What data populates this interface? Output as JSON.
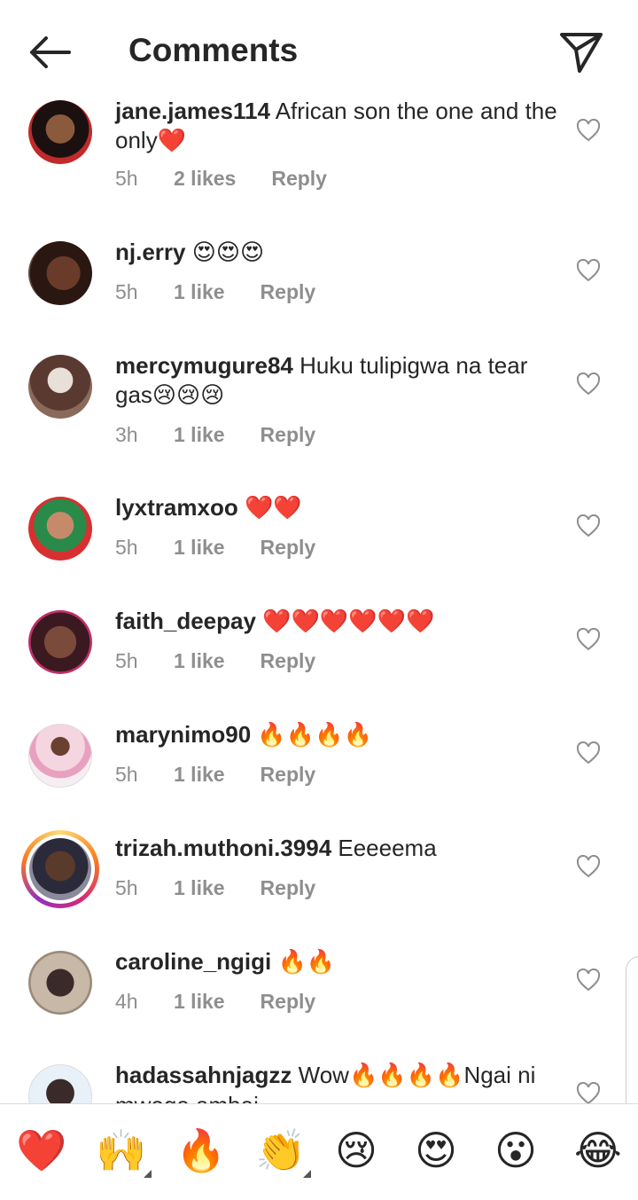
{
  "header": {
    "title": "Comments"
  },
  "comments": [
    {
      "user": "jane.james114",
      "text": " African son the one and the only",
      "emoji": "❤️",
      "time": "5h",
      "likes": "2 likes",
      "reply": "Reply"
    },
    {
      "user": "nj.erry",
      "text": " ",
      "emoji": "😍😍😍",
      "time": "5h",
      "likes": "1 like",
      "reply": "Reply"
    },
    {
      "user": "mercymugure84",
      "text": " Huku tulipigwa na tear gas",
      "emoji": "😢😢😢",
      "time": "3h",
      "likes": "1 like",
      "reply": "Reply"
    },
    {
      "user": "lyxtramxoo",
      "text": " ",
      "emoji": "❤️❤️",
      "time": "5h",
      "likes": "1 like",
      "reply": "Reply"
    },
    {
      "user": "faith_deepay",
      "text": " ",
      "emoji": "❤️❤️❤️❤️❤️❤️",
      "time": "5h",
      "likes": "1 like",
      "reply": "Reply"
    },
    {
      "user": "marynimo90",
      "text": " ",
      "emoji": "🔥🔥🔥🔥",
      "time": "5h",
      "likes": "1 like",
      "reply": "Reply"
    },
    {
      "user": "trizah.muthoni.3994",
      "text": " Eeeeema",
      "emoji": "",
      "time": "5h",
      "likes": "1 like",
      "reply": "Reply"
    },
    {
      "user": "caroline_ngigi",
      "text": " ",
      "emoji": "🔥🔥",
      "time": "4h",
      "likes": "1 like",
      "reply": "Reply"
    },
    {
      "user": "hadassahnjagzz",
      "text": " Wow",
      "emoji": "🔥🔥🔥🔥",
      "text2": "Ngai ni mwega ambai",
      "time": "",
      "likes": "",
      "reply": ""
    }
  ],
  "reactions": [
    "❤️",
    "🙌",
    "🔥",
    "👏",
    "😢",
    "😍",
    "😮",
    "😂"
  ],
  "colors": {
    "text": "#262626",
    "meta": "#8e8e8e",
    "heart": "#ed4956",
    "divider": "#dbdbdb"
  }
}
